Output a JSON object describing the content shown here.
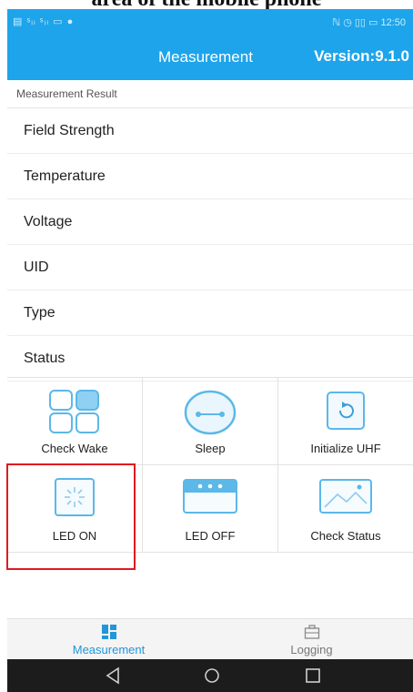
{
  "caption": "area of the mobile phone",
  "status_bar": {
    "left": "▤ ˢᵢₗ ˢᵢₗ ▭ ●",
    "right": "ℕ ◷ ▯▯ ▭ 12:50"
  },
  "app_bar": {
    "title": "Measurement",
    "version": "Version:9.1.0"
  },
  "section_label": "Measurement Result",
  "fields": [
    "Field Strength",
    "Temperature",
    "Voltage",
    "UID",
    "Type",
    "Status"
  ],
  "actions": [
    {
      "label": "Check Wake",
      "icon": "grid-icon"
    },
    {
      "label": "Sleep",
      "icon": "sleep-face-icon"
    },
    {
      "label": "Initialize UHF",
      "icon": "refresh-icon"
    },
    {
      "label": "LED ON",
      "icon": "led-on-icon"
    },
    {
      "label": "LED OFF",
      "icon": "led-off-icon"
    },
    {
      "label": "Check Status",
      "icon": "image-check-icon"
    }
  ],
  "tabs": [
    {
      "label": "Measurement",
      "active": true,
      "color": "#2196d8"
    },
    {
      "label": "Logging",
      "active": false,
      "color": "#777777"
    }
  ],
  "colors": {
    "primary": "#1ea4ea",
    "highlight": "#e0191f",
    "icon_blue": "#5bb8e8"
  }
}
